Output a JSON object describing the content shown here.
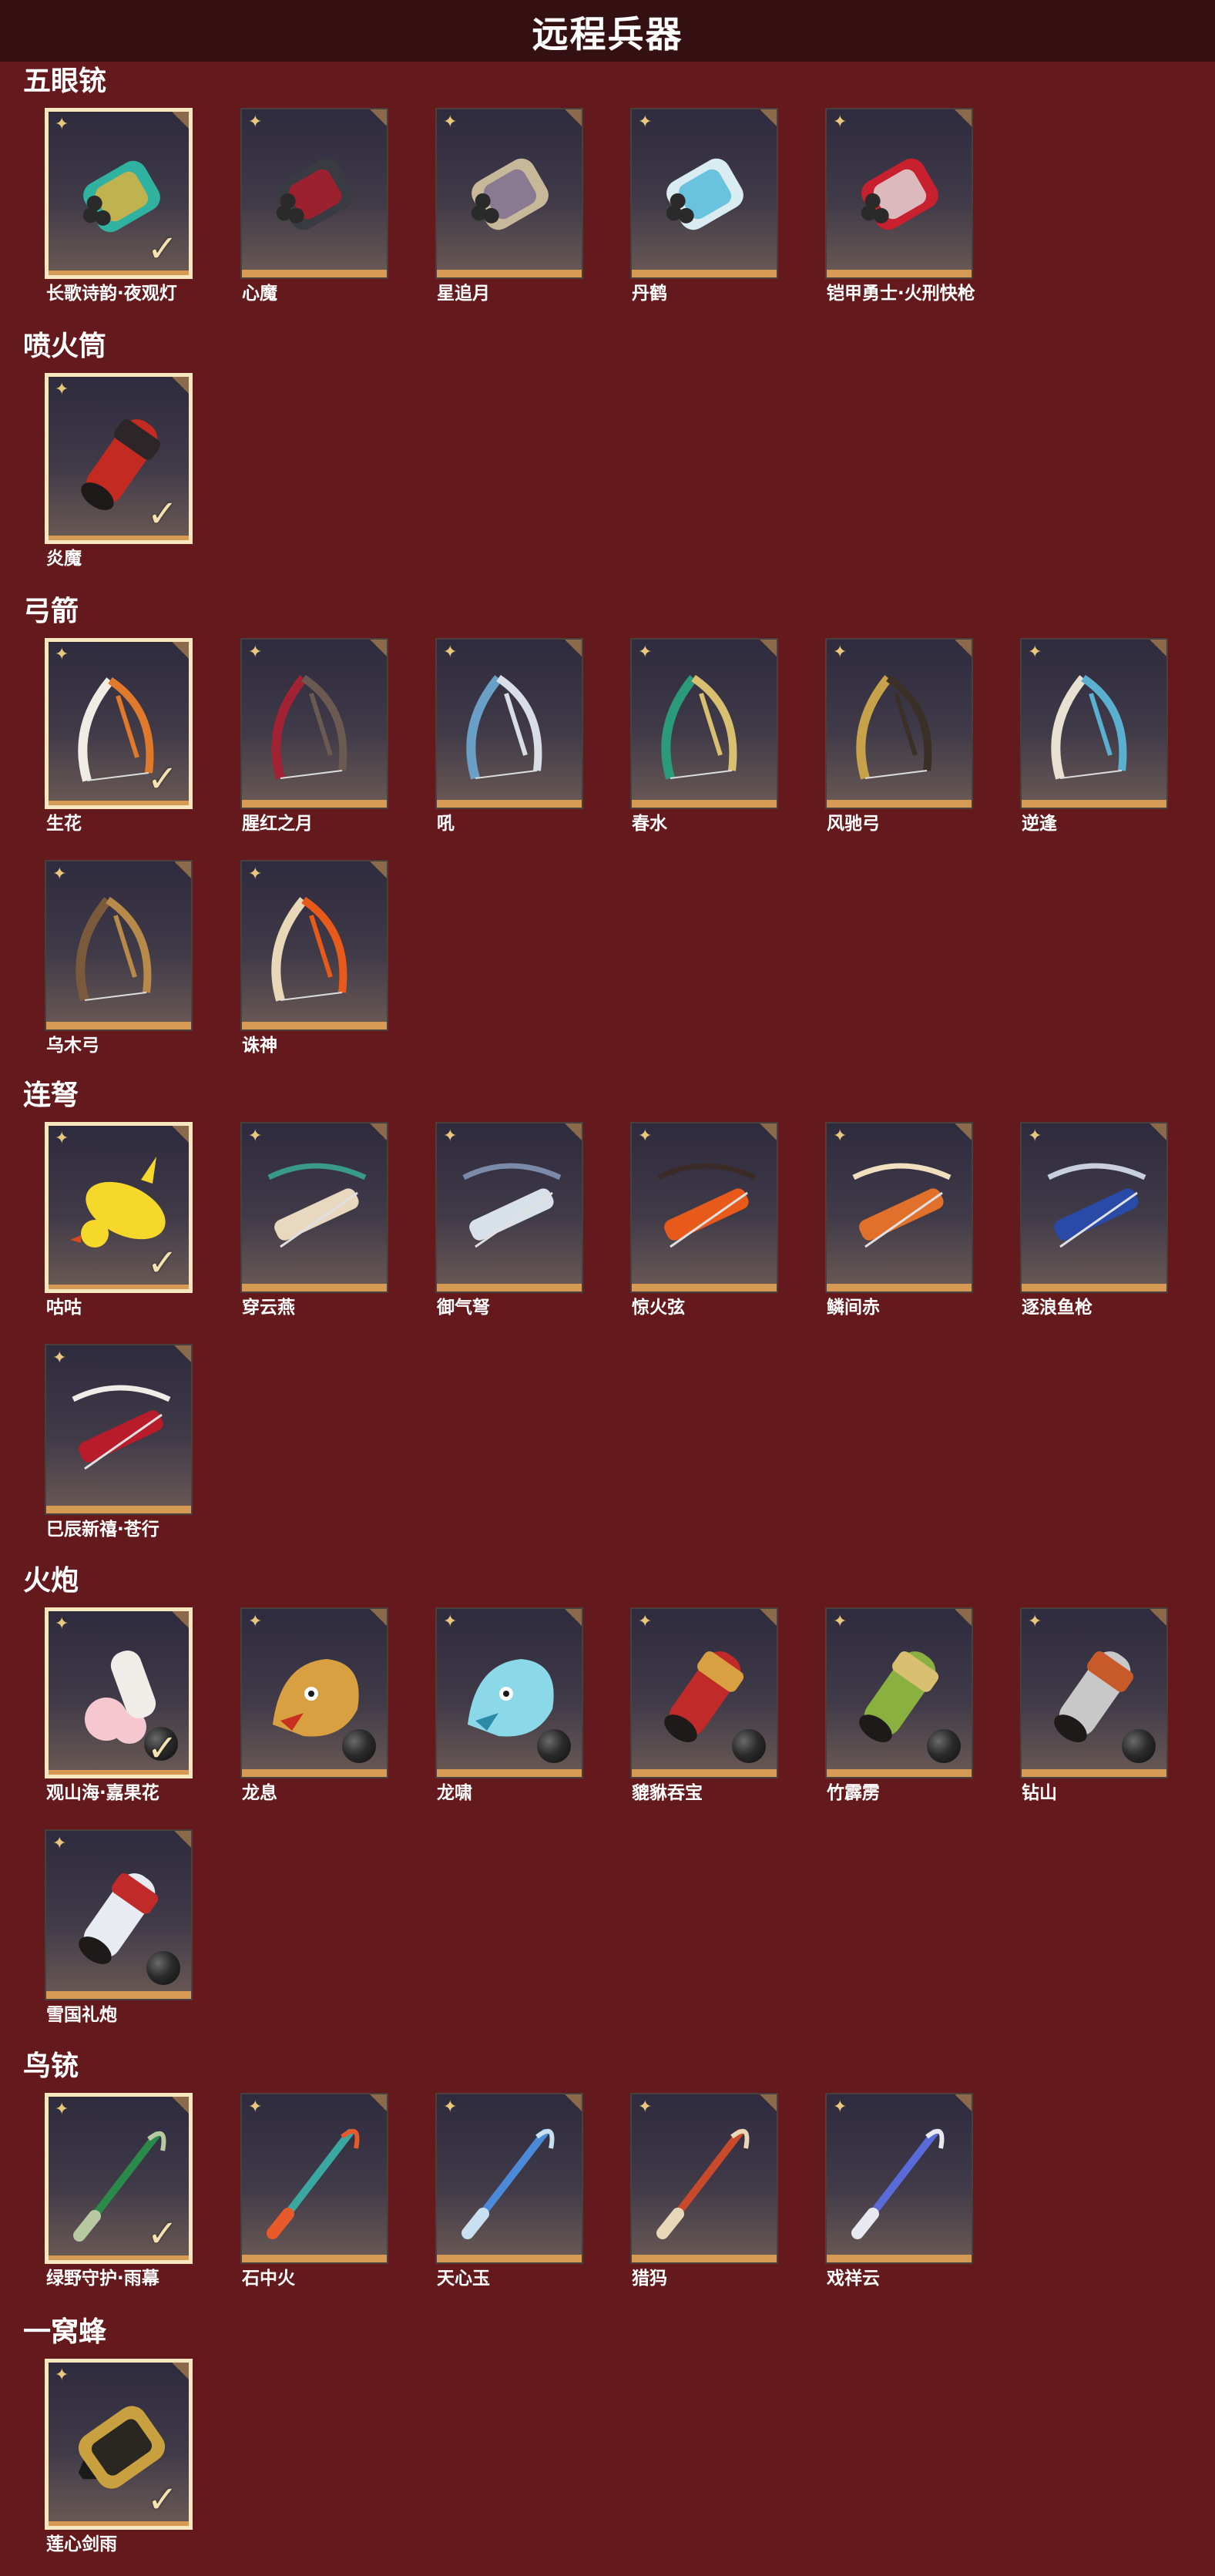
{
  "title": "远程兵器",
  "sections": [
    {
      "heading": "五眼铳",
      "items": [
        {
          "label": "长歌诗韵·夜观灯",
          "selected": true,
          "ball": false,
          "art": "cannon",
          "colors": [
            "#2fb3a0",
            "#e6b13c"
          ]
        },
        {
          "label": "心魔",
          "selected": false,
          "ball": false,
          "art": "cannon",
          "colors": [
            "#3a3a42",
            "#b41c2a"
          ]
        },
        {
          "label": "星追月",
          "selected": false,
          "ball": false,
          "art": "cannon",
          "colors": [
            "#c8b89a",
            "#7a6a8e"
          ]
        },
        {
          "label": "丹鹤",
          "selected": false,
          "ball": false,
          "art": "cannon",
          "colors": [
            "#d8ecf2",
            "#4fb9d8"
          ]
        },
        {
          "label": "铠甲勇士·火刑快枪",
          "selected": false,
          "ball": false,
          "art": "cannon",
          "colors": [
            "#c8202e",
            "#e0e0e0"
          ]
        }
      ]
    },
    {
      "heading": "喷火筒",
      "items": [
        {
          "label": "炎魔",
          "selected": true,
          "ball": false,
          "art": "tube",
          "colors": [
            "#c22a22",
            "#2d2628"
          ]
        }
      ]
    },
    {
      "heading": "弓箭",
      "items": [
        {
          "label": "生花",
          "selected": true,
          "ball": false,
          "art": "bow",
          "colors": [
            "#f0ece4",
            "#e07a2a"
          ]
        },
        {
          "label": "腥红之月",
          "selected": false,
          "ball": false,
          "art": "bow",
          "colors": [
            "#a12232",
            "#6a5a52"
          ]
        },
        {
          "label": "吼",
          "selected": false,
          "ball": false,
          "art": "bow",
          "colors": [
            "#6aa0c8",
            "#d8dde6"
          ]
        },
        {
          "label": "春水",
          "selected": false,
          "ball": false,
          "art": "bow",
          "colors": [
            "#2a9a7a",
            "#d8c070"
          ]
        },
        {
          "label": "风驰弓",
          "selected": false,
          "ball": false,
          "art": "bow",
          "colors": [
            "#c8a24a",
            "#3a3028"
          ]
        },
        {
          "label": "逆逢",
          "selected": false,
          "ball": false,
          "art": "bow",
          "colors": [
            "#e8e0d0",
            "#5ab0d0"
          ]
        },
        {
          "label": "乌木弓",
          "selected": false,
          "ball": false,
          "art": "bow",
          "colors": [
            "#7a5a3a",
            "#b88a4a"
          ]
        },
        {
          "label": "诛神",
          "selected": false,
          "ball": false,
          "art": "bow",
          "colors": [
            "#e8d8b8",
            "#e85a1a"
          ]
        }
      ]
    },
    {
      "heading": "连弩",
      "items": [
        {
          "label": "咕咕",
          "selected": true,
          "ball": false,
          "art": "chick",
          "colors": [
            "#f5d82a",
            "#d84a1a"
          ]
        },
        {
          "label": "穿云燕",
          "selected": false,
          "ball": false,
          "art": "crossbow",
          "colors": [
            "#e8d8c0",
            "#3a9a8a"
          ]
        },
        {
          "label": "御气弩",
          "selected": false,
          "ball": false,
          "art": "crossbow",
          "colors": [
            "#d8e0ea",
            "#7a8aa8"
          ]
        },
        {
          "label": "惊火弦",
          "selected": false,
          "ball": false,
          "art": "crossbow",
          "colors": [
            "#e85a1a",
            "#3a2a28"
          ]
        },
        {
          "label": "鳞间赤",
          "selected": false,
          "ball": false,
          "art": "crossbow",
          "colors": [
            "#e0702a",
            "#f0e0c0"
          ]
        },
        {
          "label": "逐浪鱼枪",
          "selected": false,
          "ball": false,
          "art": "crossbow",
          "colors": [
            "#2a4aa8",
            "#c8d0e0"
          ]
        },
        {
          "label": "巳辰新禧·苍行",
          "selected": false,
          "ball": false,
          "art": "crossbow",
          "colors": [
            "#b81c2a",
            "#f0ece8"
          ]
        }
      ]
    },
    {
      "heading": "火炮",
      "items": [
        {
          "label": "观山海·嘉果花",
          "selected": true,
          "ball": true,
          "art": "flower",
          "colors": [
            "#f5c8d0",
            "#f0ece8"
          ]
        },
        {
          "label": "龙息",
          "selected": false,
          "ball": true,
          "art": "dragon",
          "colors": [
            "#d8a040",
            "#c83020"
          ]
        },
        {
          "label": "龙啸",
          "selected": false,
          "ball": true,
          "art": "dragon",
          "colors": [
            "#8ad8e8",
            "#2a8aa8"
          ]
        },
        {
          "label": "貔貅吞宝",
          "selected": false,
          "ball": true,
          "art": "tube",
          "colors": [
            "#c02a28",
            "#d8a040"
          ]
        },
        {
          "label": "竹霹雳",
          "selected": false,
          "ball": true,
          "art": "tube",
          "colors": [
            "#8ab040",
            "#d8c070"
          ]
        },
        {
          "label": "钻山",
          "selected": false,
          "ball": true,
          "art": "tube",
          "colors": [
            "#c8c8c8",
            "#c85a2a"
          ]
        },
        {
          "label": "雪国礼炮",
          "selected": false,
          "ball": true,
          "art": "tube",
          "colors": [
            "#e8ecf2",
            "#c02a28"
          ]
        }
      ]
    },
    {
      "heading": "鸟铳",
      "items": [
        {
          "label": "绿野守护·雨幕",
          "selected": true,
          "ball": false,
          "art": "rifle",
          "colors": [
            "#2a8a4a",
            "#b8c8a0"
          ]
        },
        {
          "label": "石中火",
          "selected": false,
          "ball": false,
          "art": "rifle",
          "colors": [
            "#3aa8a0",
            "#e85a2a"
          ]
        },
        {
          "label": "天心玉",
          "selected": false,
          "ball": false,
          "art": "rifle",
          "colors": [
            "#4a8ad8",
            "#c8e0f0"
          ]
        },
        {
          "label": "猎犸",
          "selected": false,
          "ball": false,
          "art": "rifle",
          "colors": [
            "#c84a2a",
            "#e8d8b8"
          ]
        },
        {
          "label": "戏祥云",
          "selected": false,
          "ball": false,
          "art": "rifle",
          "colors": [
            "#5a6ad8",
            "#e8e8f0"
          ]
        }
      ]
    },
    {
      "heading": "一窝蜂",
      "items": [
        {
          "label": "莲心剑雨",
          "selected": true,
          "ball": false,
          "art": "hive",
          "colors": [
            "#c8a040",
            "#2a2620"
          ]
        }
      ]
    }
  ]
}
